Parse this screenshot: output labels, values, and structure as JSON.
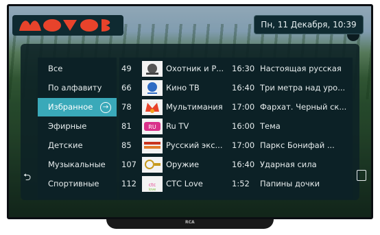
{
  "app": {
    "datetime": "Пн, 11 Декабря, 10:39",
    "accent_color": "#3aa9b9",
    "brand_color": "#e8432b",
    "tv_brand": "RCA"
  },
  "categories": [
    {
      "label": "Все",
      "active": false
    },
    {
      "label": "По алфавиту",
      "active": false
    },
    {
      "label": "Избранное",
      "active": true
    },
    {
      "label": "Эфирные",
      "active": false
    },
    {
      "label": "Детские",
      "active": false
    },
    {
      "label": "Музыкальные",
      "active": false
    },
    {
      "label": "Спортивные",
      "active": false
    }
  ],
  "channels": [
    {
      "number": "49",
      "name": "Охотник и Р...",
      "time": "16:30",
      "program": "Настоящая русская",
      "logo": "hunter-fisher-logo"
    },
    {
      "number": "66",
      "name": "Кино ТВ",
      "time": "16:40",
      "program": "Три метра над уро...",
      "logo": "kino-tv-logo"
    },
    {
      "number": "78",
      "name": "Мультимания",
      "time": "17:00",
      "program": "Фархат. Черный ск...",
      "logo": "multimania-logo"
    },
    {
      "number": "81",
      "name": "Ru TV",
      "time": "16:00",
      "program": "Тема",
      "logo": "ru-tv-logo"
    },
    {
      "number": "85",
      "name": "Русский экс...",
      "time": "17:00",
      "program": "Паркс Бонифай ...",
      "logo": "russkiy-extreme-logo"
    },
    {
      "number": "107",
      "name": "Оружие",
      "time": "16:40",
      "program": "Ударная сила",
      "logo": "oruzhie-logo"
    },
    {
      "number": "112",
      "name": "СТС Love",
      "time": "1:52",
      "program": "Папины дочки",
      "logo": "ctc-love-logo"
    }
  ],
  "icons": {
    "back": "back-arrow-icon",
    "record": "record-icon",
    "selected": "arrow-right-circle-icon"
  }
}
